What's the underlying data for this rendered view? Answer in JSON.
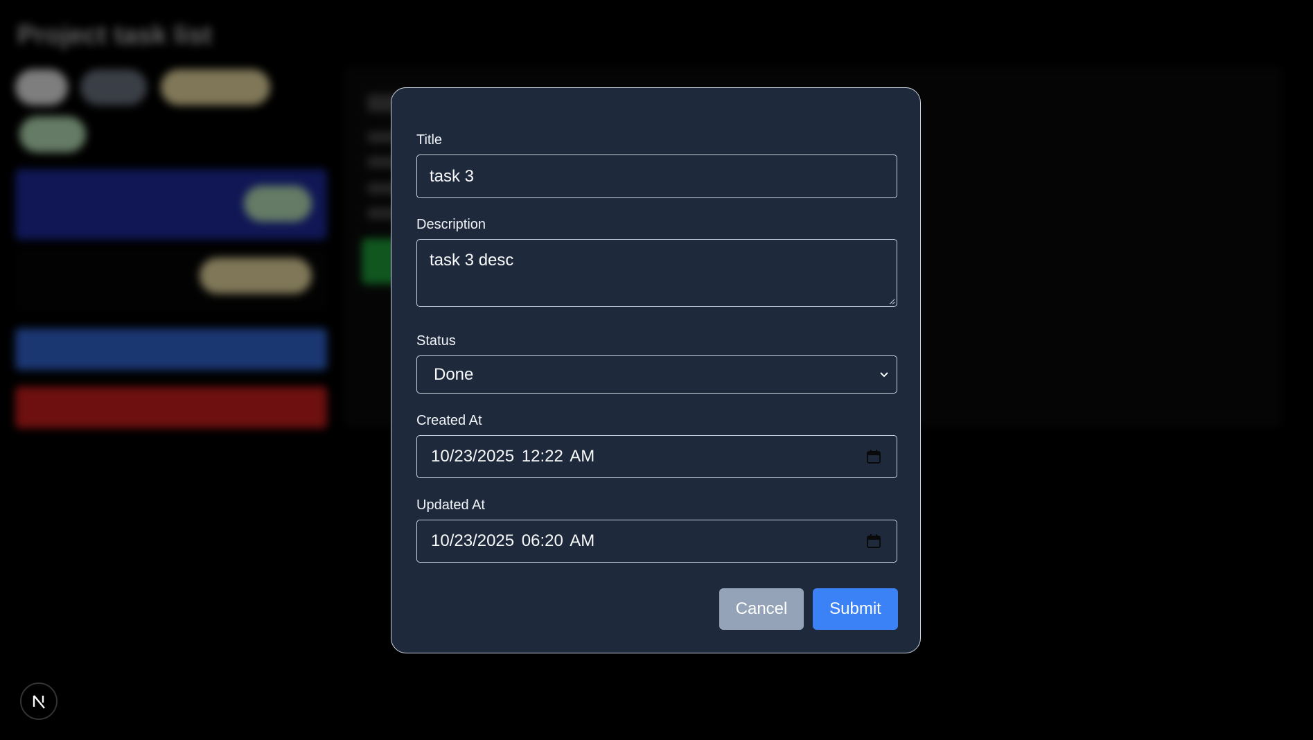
{
  "background": {
    "page_title": "Project task list"
  },
  "modal": {
    "fields": {
      "title": {
        "label": "Title",
        "value": "task 3"
      },
      "description": {
        "label": "Description",
        "value": "task 3 desc"
      },
      "status": {
        "label": "Status",
        "value": "Done"
      },
      "created_at": {
        "label": "Created At",
        "value": "10/23/2025 12:22 AM"
      },
      "updated_at": {
        "label": "Updated At",
        "value": "10/23/2025 06:20 AM"
      }
    },
    "buttons": {
      "cancel": "Cancel",
      "submit": "Submit"
    }
  },
  "colors": {
    "modal_bg": "#1e293b",
    "border": "#cbd5e1",
    "cancel": "#94a3b8",
    "submit": "#3b82f6"
  },
  "icons": {
    "select": "chevron-down-icon",
    "date": "calendar-icon",
    "badge": "nextjs-logo-icon"
  }
}
